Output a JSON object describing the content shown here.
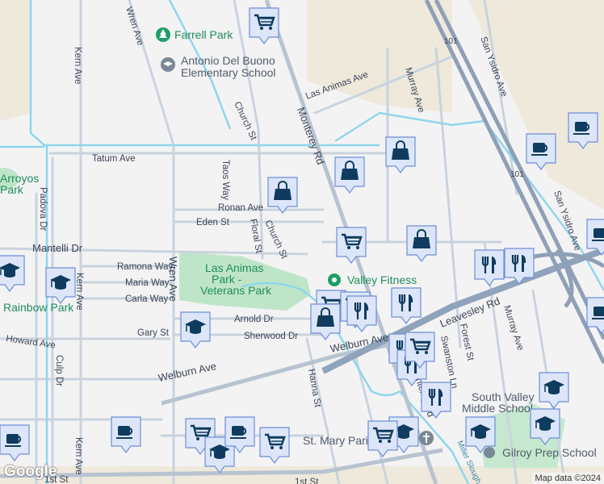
{
  "map": {
    "roads": {
      "wren_ave": "Wren Ave",
      "kern_ave": "Kern Ave",
      "kern_ave_2": "Kern Ave",
      "church_st": "Church St",
      "church_st_2": "Church St",
      "monterey_rd": "Monterey Rd",
      "monterey_rd_2": "Monterey Rd",
      "las_animas_ave": "Las Animas Ave",
      "murray_ave": "Murray Ave",
      "murray_ave_2": "Murray Ave",
      "san_ysidro_ave": "San Ysidro Ave",
      "san_ysidro_ave_2": "San Ysidro Ave",
      "tatum_ave": "Tatum Ave",
      "taos_way": "Taos Way",
      "ronan_ave": "Ronan Ave",
      "eden_st": "Eden St",
      "floral_st": "Floral St",
      "padova_dr": "Padova Dr",
      "mantelli_dr": "Mantelli Dr",
      "ramona_way": "Ramona Way",
      "maria_way": "Maria Way",
      "carla_way": "Carla Way",
      "wren_ave_2": "Wren Ave",
      "arnold_dr": "Arnold Dr",
      "sherwood_dr": "Sherwood Dr",
      "gary_st": "Gary St",
      "howard_ave": "Howard Ave",
      "culp_dr": "Culp Dr",
      "welburn_ave": "Welburn Ave",
      "welburn_ave_2": "Welburn Ave",
      "leavesley_rd": "Leavesley Rd",
      "hanna_st": "Hanna St",
      "forest_st": "Forest St",
      "swanston_ln": "Swanston Ln",
      "miller_slough": "Miller Slough",
      "first_st": "1st St",
      "first_st_2": "1st St",
      "hwy_101": "101",
      "hwy_101_2": "101"
    },
    "places": {
      "farrell_park": "Farrell Park",
      "school_line1": "Antonio Del Buono",
      "school_line2": "Elementary School",
      "arroyos_park_1": "Arroyos",
      "arroyos_park_2": "Park",
      "las_animas_park_1": "Las Animas",
      "las_animas_park_2": "Park -",
      "las_animas_park_3": "Veterans Park",
      "rainbow_park": "Rainbow Park",
      "valley_fitness": "Valley Fitness",
      "south_valley_1": "South Valley",
      "south_valley_2": "Middle School",
      "gilroy_prep": "Gilroy Prep School",
      "st_mary": "St. Mary Paris"
    },
    "markers": [
      "cart",
      "bag",
      "bag",
      "bag",
      "cart",
      "bag",
      "coffee",
      "coffee",
      "coffee",
      "coffee",
      "fork",
      "fork",
      "grad",
      "grad",
      "grad",
      "cart",
      "bag",
      "cart",
      "fork",
      "fork",
      "fork",
      "fork",
      "cart",
      "fork",
      "grad",
      "grad",
      "grad",
      "grad",
      "cart",
      "coffee",
      "coffee",
      "cart",
      "grad",
      "coffee",
      "cart"
    ],
    "attribution": "Map data ©2024",
    "logo": "Google"
  },
  "colors": {
    "marker_fill": "#dde6f9",
    "marker_border": "#6b8fd8",
    "marker_icon": "#0f3b5f",
    "park": "#bfe5c8",
    "water": "#8fd6ec"
  }
}
